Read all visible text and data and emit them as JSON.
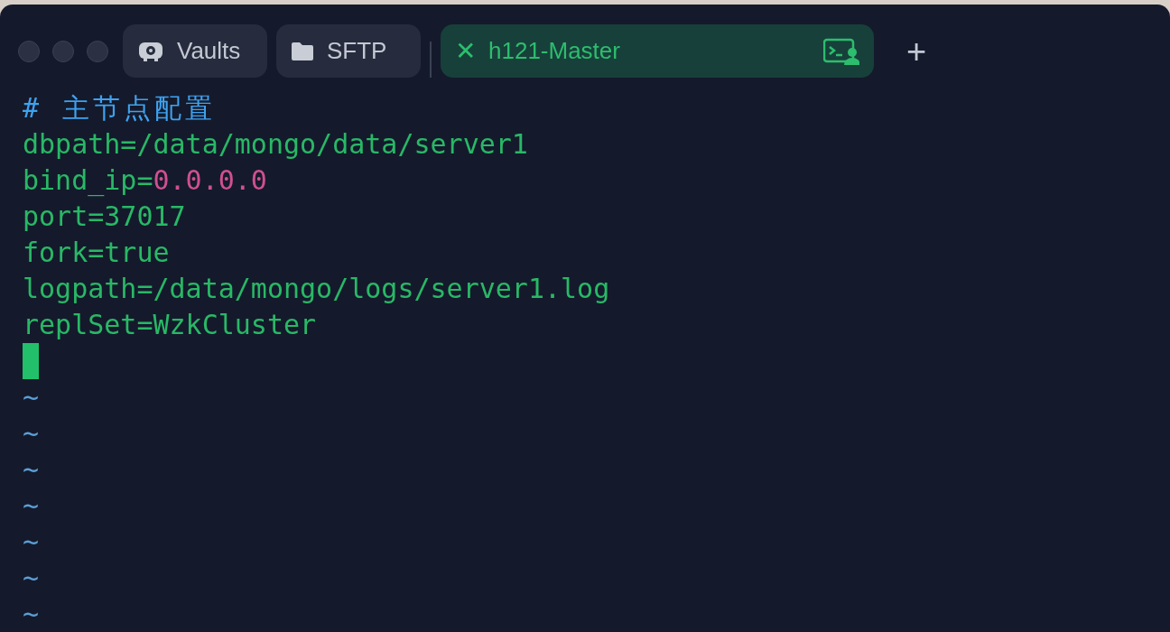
{
  "tabs": [
    {
      "kind": "vaults",
      "label": "Vaults",
      "selected": false
    },
    {
      "kind": "sftp",
      "label": "SFTP",
      "selected": false
    },
    {
      "kind": "host",
      "label": "h121-Master",
      "close": "✕",
      "selected": true
    }
  ],
  "new_tab": "+",
  "editor": {
    "lines": [
      {
        "kind": "text",
        "parts": [
          {
            "kind": "comment",
            "text": "# 主节点配置"
          }
        ]
      },
      {
        "kind": "text",
        "parts": [
          {
            "kind": "plain",
            "text": "dbpath=/data/mongo/data/server1"
          }
        ]
      },
      {
        "kind": "text",
        "parts": [
          {
            "kind": "plain",
            "text": "bind_ip="
          },
          {
            "kind": "number",
            "text": "0.0.0.0"
          }
        ]
      },
      {
        "kind": "text",
        "parts": [
          {
            "kind": "plain",
            "text": "port=37017"
          }
        ]
      },
      {
        "kind": "text",
        "parts": [
          {
            "kind": "plain",
            "text": "fork=true"
          }
        ]
      },
      {
        "kind": "text",
        "parts": [
          {
            "kind": "plain",
            "text": "logpath=/data/mongo/logs/server1.log"
          }
        ]
      },
      {
        "kind": "text",
        "parts": [
          {
            "kind": "plain",
            "text": "replSet=WzkCluster"
          }
        ]
      },
      {
        "kind": "cursor"
      },
      {
        "kind": "text",
        "parts": [
          {
            "kind": "tilde",
            "text": "~"
          }
        ]
      },
      {
        "kind": "text",
        "parts": [
          {
            "kind": "tilde",
            "text": "~"
          }
        ]
      },
      {
        "kind": "text",
        "parts": [
          {
            "kind": "tilde",
            "text": "~"
          }
        ]
      },
      {
        "kind": "text",
        "parts": [
          {
            "kind": "tilde",
            "text": "~"
          }
        ]
      },
      {
        "kind": "text",
        "parts": [
          {
            "kind": "tilde",
            "text": "~"
          }
        ]
      },
      {
        "kind": "text",
        "parts": [
          {
            "kind": "tilde",
            "text": "~"
          }
        ]
      },
      {
        "kind": "text",
        "parts": [
          {
            "kind": "tilde",
            "text": "~"
          }
        ]
      }
    ]
  }
}
